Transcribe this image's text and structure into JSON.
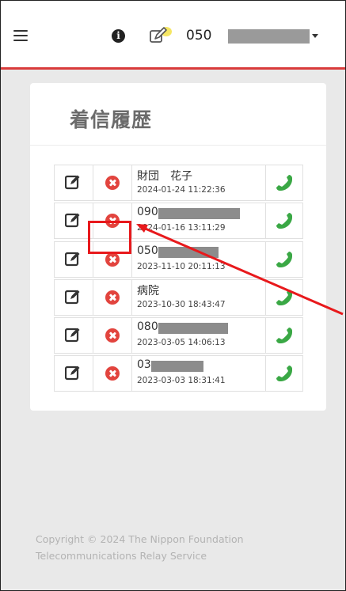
{
  "header": {
    "number_prefix": "050",
    "accent_color": "#d93b3b"
  },
  "history": {
    "title": "着信履歴",
    "rows": [
      {
        "name": "財団　花子",
        "timestamp": "2024-01-24 11:22:36"
      },
      {
        "name": "090",
        "timestamp": "2024-01-16 13:11:29"
      },
      {
        "name": "050",
        "timestamp": "2023-11-10 20:11:13"
      },
      {
        "name": "病院",
        "timestamp": "2023-10-30 18:43:47"
      },
      {
        "name": "080",
        "timestamp": "2023-03-05 14:06:13"
      },
      {
        "name": "03",
        "timestamp": "2023-03-03 18:31:41"
      }
    ]
  },
  "footer": {
    "line1": "Copyright © 2024 The Nippon Foundation",
    "line2": "Telecommunications Relay Service"
  },
  "icons": {
    "menu": "hamburger-icon",
    "info": "info-icon",
    "memo": "edit-icon",
    "delete": "delete-circle-icon",
    "call": "phone-icon"
  },
  "colors": {
    "delete": "#e2443e",
    "call": "#3aa845",
    "callout": "#e8191c"
  }
}
